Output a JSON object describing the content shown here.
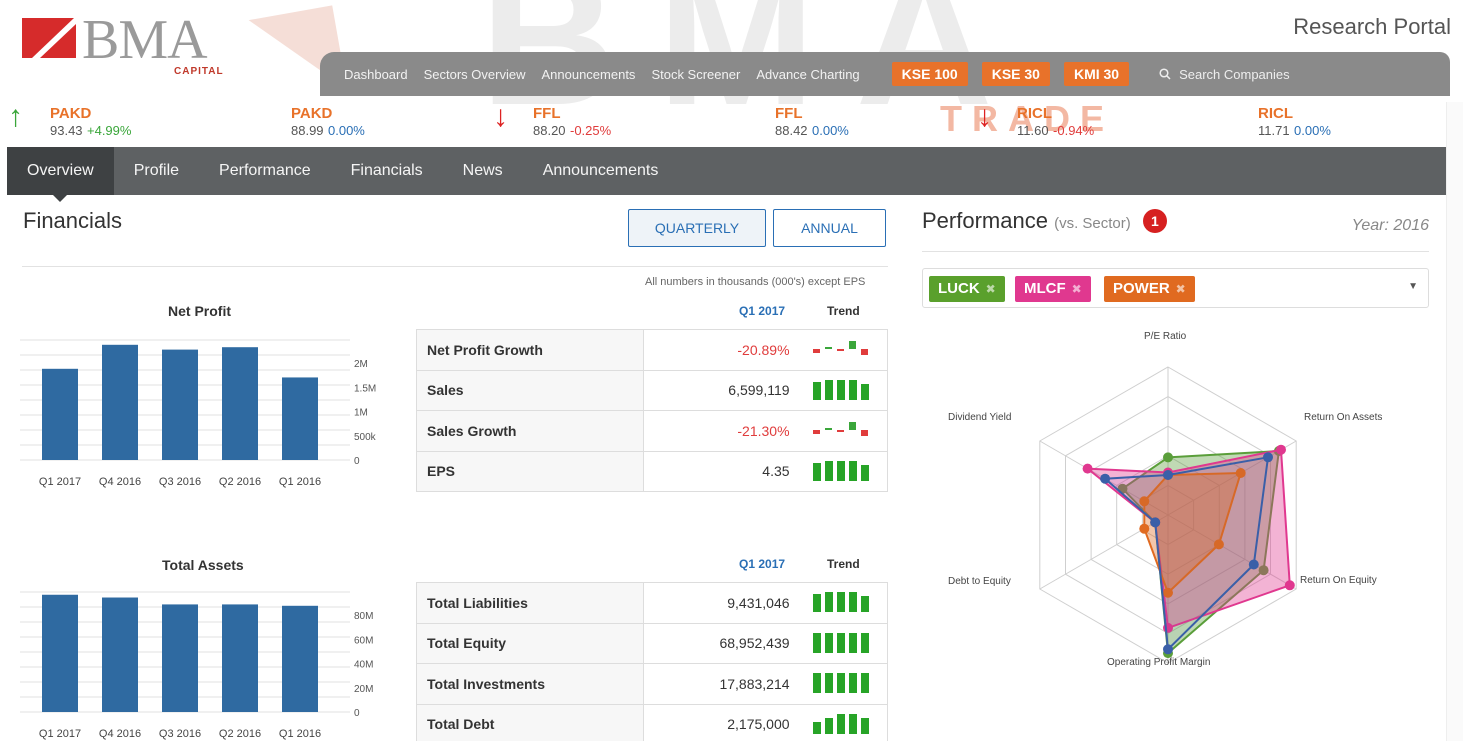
{
  "brand": {
    "name": "BMA",
    "sub": "CAPITAL",
    "portal": "Research Portal",
    "watermark": "BMA",
    "watermark2": "TRADE"
  },
  "nav": {
    "links": [
      "Dashboard",
      "Sectors Overview",
      "Announcements",
      "Stock Screener",
      "Advance Charting"
    ],
    "indices": [
      "KSE 100",
      "KSE 30",
      "KMI 30"
    ],
    "search_placeholder": "Search Companies"
  },
  "ticker": [
    {
      "symbol": "PAKD",
      "price": "93.43",
      "change": "+4.99%",
      "dir": "up"
    },
    {
      "symbol": "PAKD",
      "price": "88.99",
      "change": "0.00%",
      "dir": "zero"
    },
    {
      "symbol": "FFL",
      "price": "88.20",
      "change": "-0.25%",
      "dir": "down"
    },
    {
      "symbol": "FFL",
      "price": "88.42",
      "change": "0.00%",
      "dir": "zero"
    },
    {
      "symbol": "RICL",
      "price": "11.60",
      "change": "-0.94%",
      "dir": "down"
    },
    {
      "symbol": "RICL",
      "price": "11.71",
      "change": "0.00%",
      "dir": "zero"
    }
  ],
  "tabs": [
    "Overview",
    "Profile",
    "Performance",
    "Financials",
    "News",
    "Announcements"
  ],
  "financials": {
    "title": "Financials",
    "quarterly": "QUARTERLY",
    "annual": "ANNUAL",
    "note": "All numbers in thousands (000's) except EPS",
    "period_head": "Q1 2017",
    "trend_head": "Trend",
    "table1": [
      {
        "label": "Net Profit Growth",
        "value": "-20.89%",
        "neg": true,
        "trend": "mixed"
      },
      {
        "label": "Sales",
        "value": "6,599,119",
        "neg": false,
        "trend": "bars"
      },
      {
        "label": "Sales Growth",
        "value": "-21.30%",
        "neg": true,
        "trend": "mixed"
      },
      {
        "label": "EPS",
        "value": "4.35",
        "neg": false,
        "trend": "bars"
      }
    ],
    "table2": [
      {
        "label": "Total Liabilities",
        "value": "9,431,046",
        "neg": false,
        "trend": "bars"
      },
      {
        "label": "Total Equity",
        "value": "68,952,439",
        "neg": false,
        "trend": "flat"
      },
      {
        "label": "Total Investments",
        "value": "17,883,214",
        "neg": false,
        "trend": "flat"
      },
      {
        "label": "Total Debt",
        "value": "2,175,000",
        "neg": false,
        "trend": "rise"
      }
    ]
  },
  "chart_data": [
    {
      "type": "bar",
      "title": "Net Profit",
      "categories": [
        "Q1 2017",
        "Q4 2016",
        "Q3 2016",
        "Q2 2016",
        "Q1 2016"
      ],
      "values": [
        1900000,
        2400000,
        2300000,
        2350000,
        1720000
      ],
      "yticks": [
        "2M",
        "1.5M",
        "1M",
        "500k",
        "0"
      ],
      "ylim": [
        0,
        2500000
      ],
      "color": "#2f6aa1"
    },
    {
      "type": "bar",
      "title": "Total Assets",
      "categories": [
        "Q1 2017",
        "Q4 2016",
        "Q3 2016",
        "Q2 2016",
        "Q1 2016"
      ],
      "values": [
        85000000,
        83000000,
        78000000,
        78000000,
        77000000
      ],
      "yticks": [
        "80M",
        "60M",
        "40M",
        "20M",
        "0"
      ],
      "ylim": [
        0,
        87000000
      ],
      "color": "#2f6aa1"
    },
    {
      "type": "radar",
      "title": "Performance",
      "axes": [
        "P/E Ratio",
        "Return On Assets",
        "Return On Equity",
        "Operating Profit Margin",
        "Debt to Equity",
        "Dividend Yield"
      ],
      "series": [
        {
          "name": "LUCK",
          "color": "#5a9e3a",
          "values": [
            0.34,
            0.9,
            0.76,
            0.98,
            0.0,
            0.3
          ]
        },
        {
          "name": "MLCF",
          "color": "#e0388f",
          "values": [
            0.22,
            0.92,
            1.0,
            0.78,
            0.0,
            0.62
          ]
        },
        {
          "name": "POWER",
          "color": "#e06a20",
          "values": [
            0.2,
            0.55,
            0.35,
            0.5,
            0.1,
            0.1
          ]
        },
        {
          "name": "",
          "color": "#3a5fa8",
          "values": [
            0.2,
            0.8,
            0.67,
            0.95,
            0.0,
            0.46
          ]
        }
      ]
    }
  ],
  "performance": {
    "title": "Performance",
    "subtitle": "(vs. Sector)",
    "badge": "1",
    "year": "Year: 2016",
    "chips": [
      {
        "label": "LUCK",
        "color": "#5aa02c"
      },
      {
        "label": "MLCF",
        "color": "#e0388f"
      },
      {
        "label": "POWER",
        "color": "#e06a20"
      }
    ]
  }
}
